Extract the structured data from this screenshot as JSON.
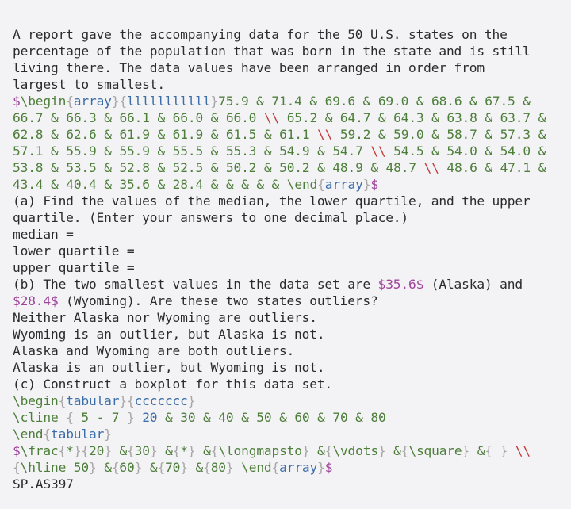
{
  "intro": {
    "line1": "A report gave the accompanying data for the 50 U.S. states on the",
    "line2": "percentage of the population that was born in the state and is still",
    "line3": "living there. The data values have been arranged in order from",
    "line4": "largest to smallest."
  },
  "array_source": {
    "dollar_open": "$",
    "begin_cmd": "\\begin",
    "env": "array",
    "colspec": "lllllllllll",
    "rows": [
      [
        "75.9",
        "71.4",
        "69.6",
        "69.0",
        "68.6",
        "67.5",
        "66.7",
        "66.3",
        "66.1",
        "66.0",
        "66.0"
      ],
      [
        "65.2",
        "64.7",
        "64.3",
        "63.8",
        "63.7",
        "62.8",
        "62.6",
        "61.9",
        "61.9",
        "61.5",
        "61.1"
      ],
      [
        "59.2",
        "59.0",
        "58.7",
        "57.3",
        "57.1",
        "55.9",
        "55.9",
        "55.5",
        "55.3",
        "54.9",
        "54.7"
      ],
      [
        "54.5",
        "54.0",
        "54.0",
        "53.8",
        "53.5",
        "52.8",
        "52.5",
        "50.2",
        "50.2",
        "48.9",
        "48.7"
      ],
      [
        "48.6",
        "47.1",
        "43.4",
        "40.4",
        "35.6",
        "28.4",
        "",
        "",
        "",
        "",
        ""
      ]
    ],
    "end_cmd": "\\end",
    "dollar_close": "$"
  },
  "part_a": {
    "prompt_line1": "(a) Find the values of the median, the lower quartile, and the upper",
    "prompt_line2": "quartile. (Enter your answers to one decimal place.)",
    "median_label": "median =",
    "lower_quartile_label": "lower quartile =",
    "upper_quartile_label": "upper quartile ="
  },
  "part_b": {
    "prompt_pre": "(b) The two smallest values in the data set are ",
    "value_alaska": "$35.6$",
    "prompt_mid": " (Alaska) and",
    "value_wyoming": "$28.4$",
    "prompt_post": " (Wyoming). Are these two states outliers?",
    "options": [
      "Neither Alaska nor Wyoming are outliers.",
      "Wyoming is an outlier, but Alaska is not.",
      "Alaska and Wyoming are both outliers.",
      "Alaska is an outlier, but Wyoming is not."
    ]
  },
  "part_c": {
    "prompt": "(c) Construct a boxplot for this data set.",
    "tabular": {
      "begin_cmd": "\\begin",
      "env": "tabular",
      "colspec": "ccccccc",
      "cline_cmd": "\\cline",
      "cline_range": " 5 - 7 ",
      "axis_values": [
        "20",
        "30",
        "40",
        "50",
        "60",
        "70",
        "80"
      ],
      "end_cmd": "\\end"
    },
    "frac_line": {
      "frac_cmd": "\\frac",
      "frac_num": "*",
      "frac_den": "20",
      "cells": [
        "30",
        "*",
        "\\longmapsto",
        "\\vdots",
        "\\square",
        " "
      ],
      "hline_cmd": "\\hline",
      "hline_value": " 50",
      "cells2": [
        "60",
        "70",
        "80"
      ],
      "end_cmd": "\\end",
      "env": "array"
    }
  },
  "footer": {
    "code": "SP.AS397"
  }
}
